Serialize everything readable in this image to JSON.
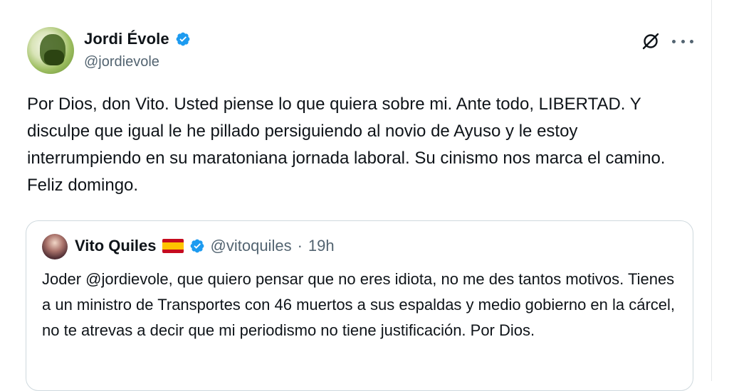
{
  "author": {
    "name": "Jordi Évole",
    "handle": "@jordievole",
    "verified": true
  },
  "tweet": {
    "text": "Por Dios, don Vito. Usted piense lo que quiera sobre mi. Ante todo, LIBERTAD. Y disculpe que igual le he pillado persiguiendo al novio de Ayuso y le estoy interrumpiendo en su maratoniana jornada laboral. Su cinismo nos marca el camino. Feliz domingo."
  },
  "actions": {
    "grok_icon": "grok-icon",
    "more_icon": "more-options-icon"
  },
  "quoted": {
    "name": "Vito Quiles",
    "flag": "🇪🇸",
    "handle": "@vitoquiles",
    "separator": "·",
    "time": "19h",
    "text": "Joder @jordievole, que quiero pensar que no eres idiota, no me des tantos motivos. Tienes a un ministro de Transportes con 46 muertos a sus espaldas y medio gobierno en la cárcel, no te atrevas a decir que mi periodismo no tiene justificación. Por Dios."
  },
  "colors": {
    "verified_blue": "#1d9bf0",
    "secondary_text": "#536471",
    "primary_text": "#0f1419",
    "border": "#cfd9de"
  }
}
